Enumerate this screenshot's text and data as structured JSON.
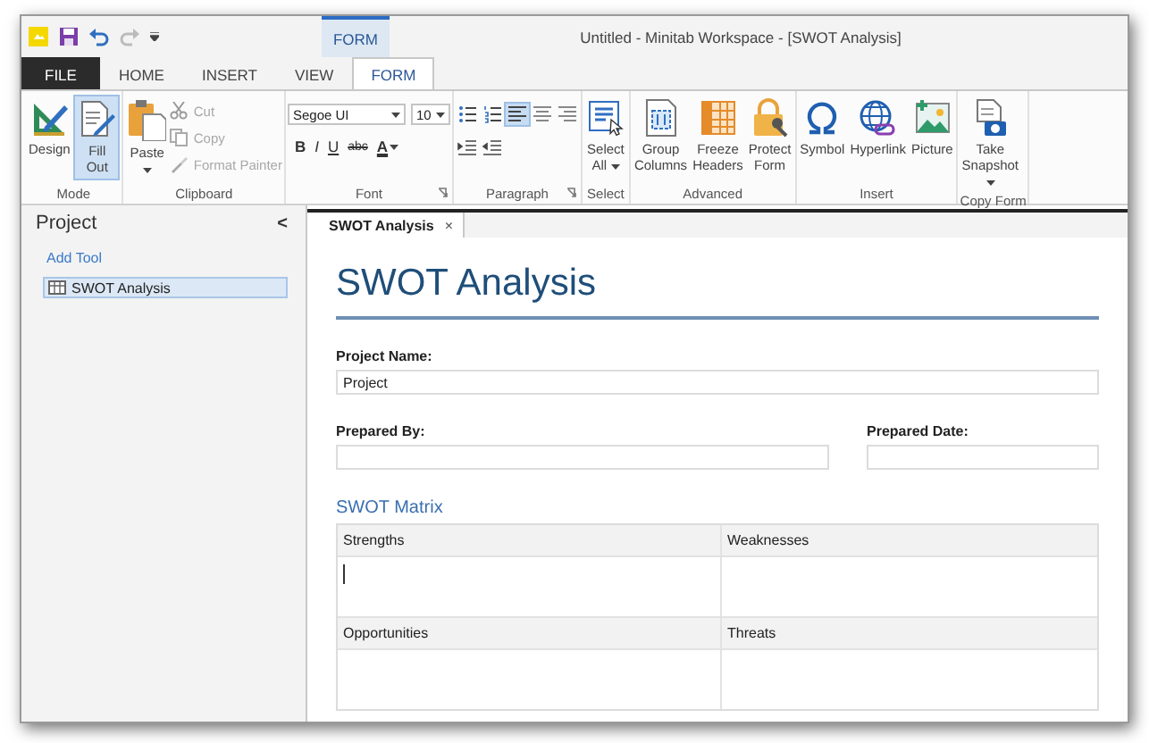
{
  "window": {
    "title": "Untitled - Minitab Workspace - [SWOT Analysis]",
    "context_tab": "FORM"
  },
  "ribbon_tabs": [
    {
      "label": "FILE",
      "kind": "file",
      "selected": false
    },
    {
      "label": "HOME",
      "kind": "tab",
      "selected": false
    },
    {
      "label": "INSERT",
      "kind": "tab",
      "selected": false
    },
    {
      "label": "VIEW",
      "kind": "tab",
      "selected": false
    },
    {
      "label": "FORM",
      "kind": "tab",
      "selected": true
    }
  ],
  "ribbon_groups": [
    {
      "label": "Mode",
      "kind": "buttons",
      "launcher": false,
      "items": [
        {
          "kind": "large",
          "label": "Design",
          "selected": false
        },
        {
          "kind": "large",
          "label": "Fill Out",
          "selected": true
        }
      ]
    },
    {
      "label": "Clipboard",
      "kind": "buttons",
      "launcher": false,
      "items": [
        {
          "kind": "large",
          "label": "Paste",
          "dropdown": true,
          "disabled": false
        },
        {
          "kind": "small",
          "label": "Cut",
          "disabled": true
        },
        {
          "kind": "small",
          "label": "Copy",
          "disabled": true
        },
        {
          "kind": "small",
          "label": "Format Painter",
          "disabled": true
        }
      ]
    },
    {
      "label": "Font",
      "kind": "font",
      "launcher": true,
      "items": [
        {
          "kind": "combo",
          "value": "Segoe UI"
        },
        {
          "kind": "combo",
          "value": "10"
        },
        {
          "kind": "bold",
          "label": "B"
        },
        {
          "kind": "italic",
          "label": "I"
        },
        {
          "kind": "underline",
          "label": "U"
        },
        {
          "kind": "strike",
          "label": "abc"
        },
        {
          "kind": "color",
          "label": "A"
        }
      ]
    },
    {
      "label": "Paragraph",
      "kind": "paragraph",
      "launcher": true,
      "items": [
        {
          "kind": "tool",
          "selected": false
        },
        {
          "kind": "tool",
          "selected": false
        },
        {
          "kind": "tool",
          "selected": true
        },
        {
          "kind": "tool",
          "selected": false
        },
        {
          "kind": "tool",
          "selected": false
        },
        {
          "kind": "tool",
          "selected": false
        },
        {
          "kind": "tool",
          "selected": false
        }
      ]
    },
    {
      "label": "Select",
      "kind": "buttons",
      "launcher": false,
      "items": [
        {
          "kind": "large",
          "label": "Select All",
          "dropdown": true
        }
      ]
    },
    {
      "label": "Advanced",
      "kind": "buttons",
      "launcher": false,
      "items": [
        {
          "kind": "large",
          "label": "Group Columns"
        },
        {
          "kind": "large",
          "label": "Freeze Headers"
        },
        {
          "kind": "large",
          "label": "Protect Form"
        }
      ]
    },
    {
      "label": "Insert",
      "kind": "buttons",
      "launcher": false,
      "items": [
        {
          "kind": "large",
          "label": "Symbol"
        },
        {
          "kind": "large",
          "label": "Hyperlink"
        },
        {
          "kind": "large",
          "label": "Picture"
        }
      ]
    },
    {
      "label": "Copy Form",
      "kind": "buttons",
      "launcher": false,
      "items": [
        {
          "kind": "large",
          "label": "Take Snapshot",
          "dropdown": true
        }
      ]
    }
  ],
  "sidebar": {
    "title": "Project",
    "collapse": "<",
    "link": "Add Tool",
    "items": [
      {
        "label": "SWOT Analysis",
        "selected": true
      }
    ]
  },
  "document": {
    "tabs": [
      {
        "label": "SWOT Analysis",
        "close": "×",
        "selected": true
      }
    ],
    "heading": "SWOT Analysis",
    "fields": [
      {
        "label": "Project Name:",
        "value": "Project",
        "kind": "full"
      },
      {
        "label": "Prepared By:",
        "kind": "wide"
      },
      {
        "label": "Prepared Date:",
        "kind": "narrow"
      }
    ],
    "section": "SWOT Matrix",
    "matrix": [
      {
        "label": "Strengths",
        "focused": true
      },
      {
        "label": "Weaknesses",
        "focused": false
      },
      {
        "label": "Opportunities",
        "focused": false
      },
      {
        "label": "Threats",
        "focused": false
      }
    ]
  }
}
